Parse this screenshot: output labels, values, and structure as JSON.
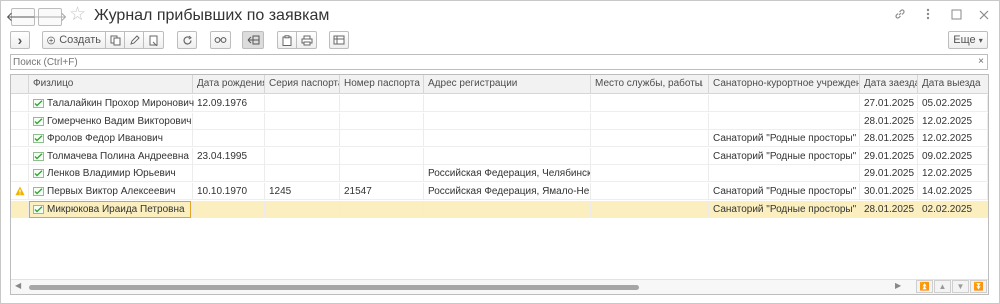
{
  "window": {
    "title": "Журнал прибывших по заявкам",
    "back_glyph": "🡐",
    "forward_glyph": "🡒",
    "star_glyph": "☆",
    "title_icons": [
      "link-icon",
      "more-vert-icon",
      "maximize-icon",
      "close-icon"
    ]
  },
  "toolbar": {
    "expand_glyph": "›",
    "create_label": "Создать",
    "more_label": "Еще",
    "more_caret": "▾"
  },
  "search": {
    "placeholder": "Поиск (Ctrl+F)",
    "clear_glyph": "×"
  },
  "table": {
    "columns": [
      "Физлицо",
      "Дата рождения",
      "Серия паспорта",
      "Номер паспорта",
      "Адрес регистрации",
      "Место службы, работы",
      "Санаторно-курортное учреждение",
      "Дата заезда",
      "Дата выезда"
    ],
    "sort_glyph": "↓",
    "rows": [
      {
        "name": "Талалайкин Прохор Миронович",
        "birth": "12.09.1976",
        "series": "",
        "number": "",
        "address": "",
        "work": "",
        "sanatorium": "",
        "arrival": "27.01.2025",
        "departure": "05.02.2025"
      },
      {
        "name": "Гомерченко Вадим Викторович",
        "birth": "",
        "series": "",
        "number": "",
        "address": "",
        "work": "",
        "sanatorium": "",
        "arrival": "28.01.2025",
        "departure": "12.02.2025"
      },
      {
        "name": "Фролов Федор Иванович",
        "birth": "",
        "series": "",
        "number": "",
        "address": "",
        "work": "",
        "sanatorium": "Санаторий \"Родные просторы\"",
        "arrival": "28.01.2025",
        "departure": "12.02.2025"
      },
      {
        "name": "Толмачева Полина Андреевна",
        "birth": "23.04.1995",
        "series": "",
        "number": "",
        "address": "",
        "work": "",
        "sanatorium": "Санаторий \"Родные просторы\"",
        "arrival": "29.01.2025",
        "departure": "09.02.2025"
      },
      {
        "name": "Ленков Владимир Юрьевич",
        "birth": "",
        "series": "",
        "number": "",
        "address": "Российская Федерация, Челябинска...",
        "work": "",
        "sanatorium": "",
        "arrival": "29.01.2025",
        "departure": "12.02.2025"
      },
      {
        "name": "Первых Виктор Алексеевич",
        "birth": "10.10.1970",
        "series": "1245",
        "number": "21547",
        "address": "Российская Федерация, Ямало-Нен...",
        "work": "",
        "sanatorium": "Санаторий \"Родные просторы\"",
        "arrival": "30.01.2025",
        "departure": "14.02.2025",
        "warning": true
      },
      {
        "name": "Микрюкова Ираида Петровна",
        "birth": "",
        "series": "",
        "number": "",
        "address": "",
        "work": "",
        "sanatorium": "Санаторий \"Родные просторы\"",
        "arrival": "28.01.2025",
        "departure": "02.02.2025",
        "selected": true
      }
    ]
  },
  "colors": {
    "selected_row": "#fbefbf",
    "selected_outline": "#e4a520",
    "header_bg": "#f2f2f2",
    "warning": "#f0b400",
    "doc_icon": "#3aa13a"
  }
}
